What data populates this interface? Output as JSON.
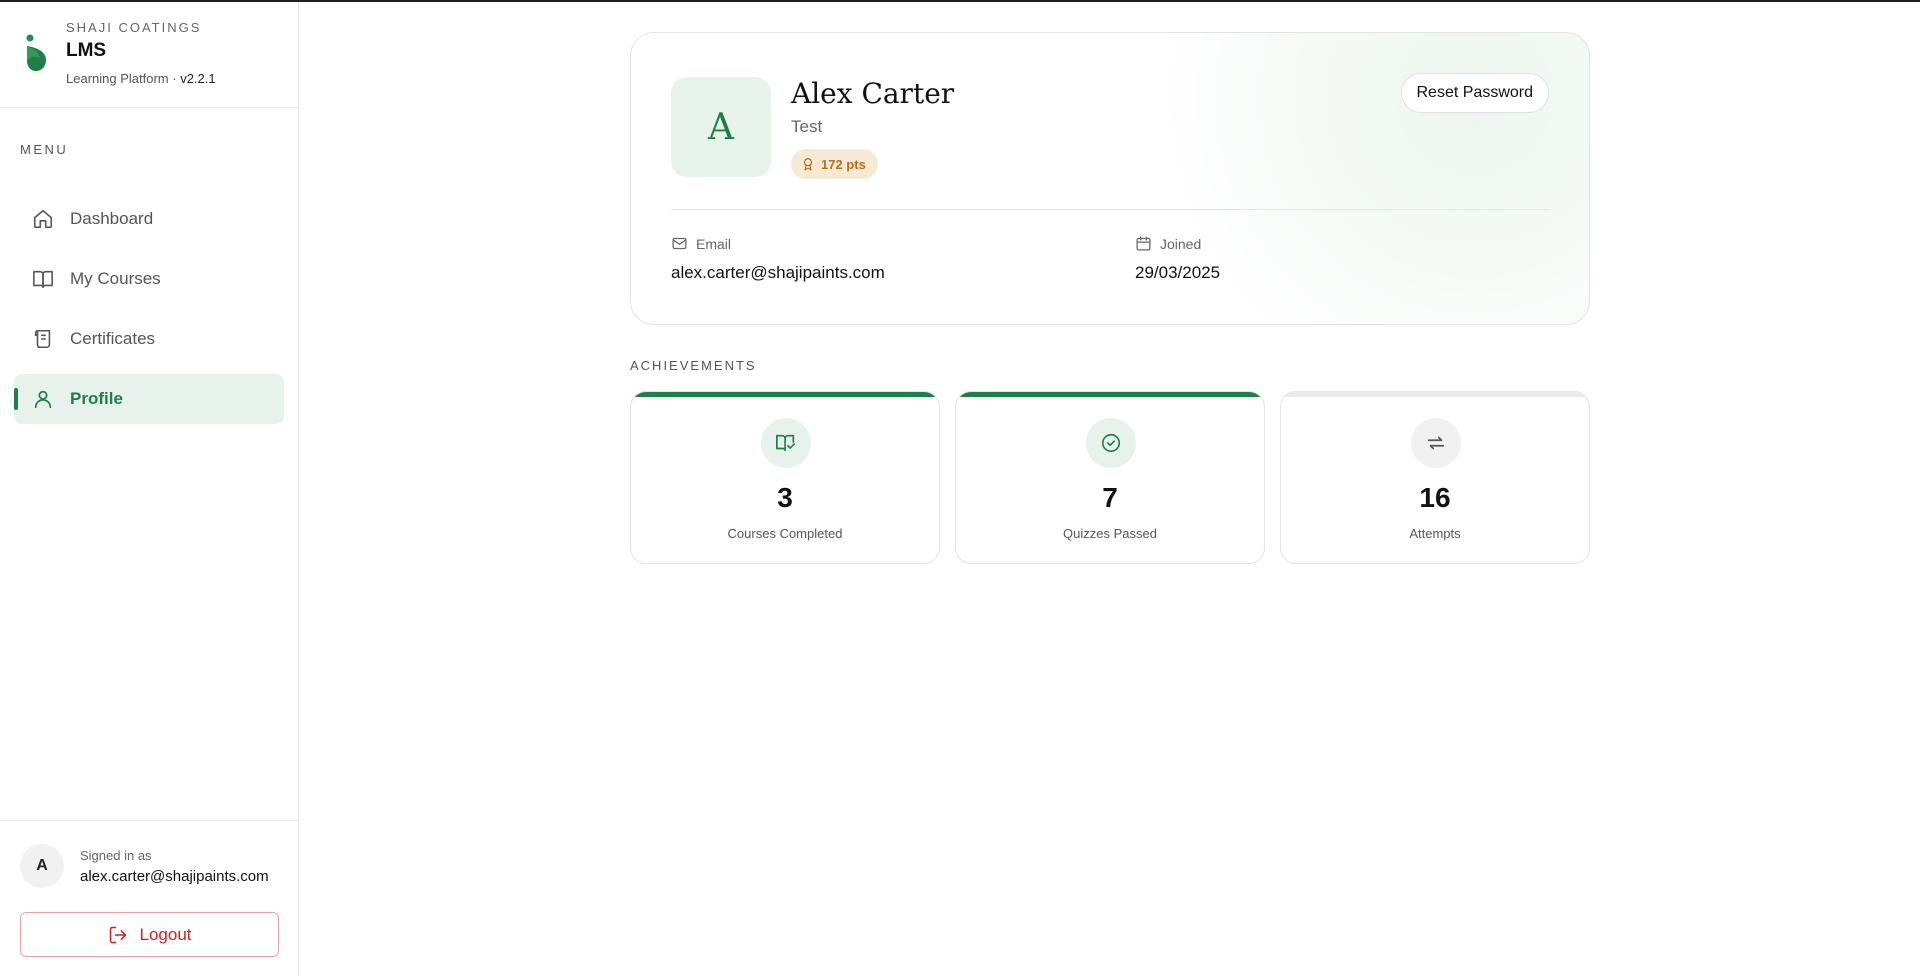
{
  "brand": {
    "company": "SHAJI COATINGS",
    "title": "LMS",
    "subtitle": "Learning Platform ·",
    "version": "v2.2.1",
    "accent_color": "#1e8048"
  },
  "sidebar": {
    "menu_label": "MENU",
    "items": [
      {
        "label": "Dashboard",
        "icon": "home-icon",
        "active": false
      },
      {
        "label": "My Courses",
        "icon": "book-open-icon",
        "active": false
      },
      {
        "label": "Certificates",
        "icon": "scroll-icon",
        "active": false
      },
      {
        "label": "Profile",
        "icon": "user-icon",
        "active": true
      }
    ],
    "signed_in_label": "Signed in as",
    "signed_in_email": "alex.carter@shajipaints.com",
    "avatar_initial": "A",
    "logout_label": "Logout"
  },
  "profile": {
    "initial": "A",
    "name": "Alex Carter",
    "role": "Test",
    "points": "172 pts",
    "reset_password_label": "Reset Password",
    "email_label": "Email",
    "email": "alex.carter@shajipaints.com",
    "joined_label": "Joined",
    "joined": "29/03/2025"
  },
  "achievements": {
    "title": "ACHIEVEMENTS",
    "cards": [
      {
        "value": "3",
        "label": "Courses Completed",
        "icon": "book-check-icon",
        "progress": 1.0
      },
      {
        "value": "7",
        "label": "Quizzes Passed",
        "icon": "check-circle-icon",
        "progress": 1.0
      },
      {
        "value": "16",
        "label": "Attempts",
        "icon": "repeat-icon",
        "progress": 0.0
      }
    ]
  }
}
